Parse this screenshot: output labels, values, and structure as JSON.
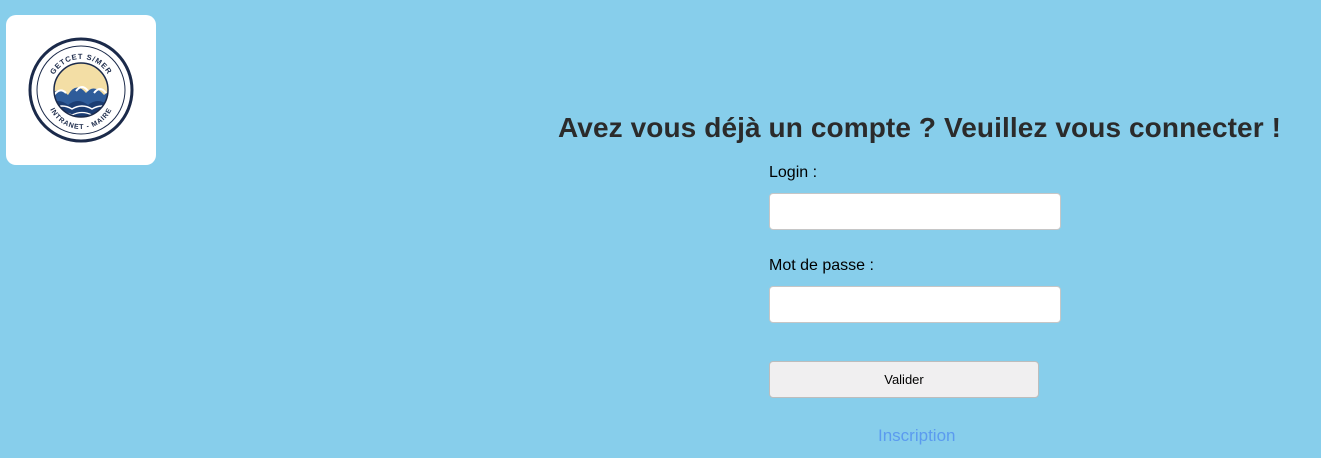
{
  "logo": {
    "icon": "getcet-smer-logo",
    "top_text": "GETCET S/MER",
    "bottom_text": "INTRANET - MAIRE"
  },
  "login_form": {
    "heading": "Avez vous déjà un compte ? Veuillez vous connecter !",
    "login_label": "Login :",
    "login_value": "",
    "password_label": "Mot de passe :",
    "password_value": "",
    "submit_label": "Valider",
    "register_link": "Inscription"
  },
  "colors": {
    "page_background": "#87ceeb",
    "heading": "#2b2b2b",
    "link": "#5b9bef",
    "logo_navy": "#1b2a4a",
    "logo_sand": "#f3dea5",
    "logo_wave": "#2e5c9a"
  }
}
